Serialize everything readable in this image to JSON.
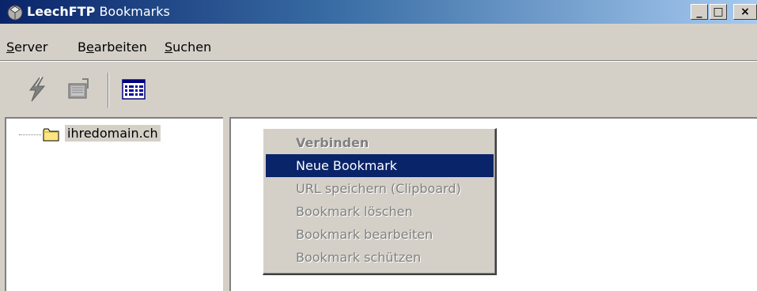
{
  "window": {
    "title_app": "LeechFTP",
    "title_rest": "Bookmarks",
    "minimize_label": "_",
    "maximize_label": "□",
    "close_label": "×"
  },
  "menubar": {
    "items": [
      {
        "first": "S",
        "rest": "erver"
      },
      {
        "first": "B",
        "mid": "e",
        "rest": "arbeiten",
        "underline_index": 1
      },
      {
        "first": "S",
        "rest": "uchen"
      }
    ]
  },
  "toolbar": {
    "icons": [
      "connect-lightning-icon",
      "bookmark-manager-icon",
      "list-view-icon"
    ]
  },
  "tree": {
    "items": [
      {
        "label": "ihredomain.ch",
        "icon": "folder-icon"
      }
    ]
  },
  "context_menu": {
    "items": [
      {
        "label": "Verbinden",
        "state": "default-disabled"
      },
      {
        "label": "Neue Bookmark",
        "state": "selected"
      },
      {
        "label": "URL speichern (Clipboard)",
        "state": "disabled"
      },
      {
        "label": "Bookmark löschen",
        "state": "disabled"
      },
      {
        "label": "Bookmark bearbeiten",
        "state": "disabled"
      },
      {
        "label": "Bookmark schützen",
        "state": "disabled"
      }
    ]
  },
  "colors": {
    "titlebar_start": "#0a246a",
    "titlebar_end": "#a6caf0",
    "selection": "#0a246a",
    "face": "#d4d0c8"
  }
}
